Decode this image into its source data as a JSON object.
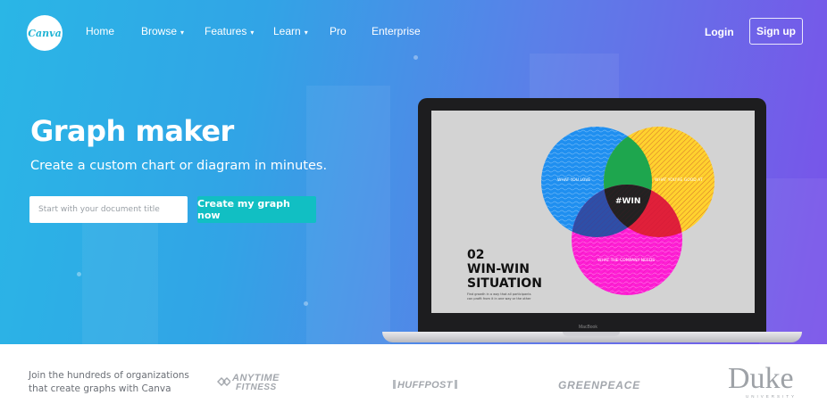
{
  "brand": {
    "logo_text": "Canva"
  },
  "nav": {
    "items": [
      {
        "label": "Home"
      },
      {
        "label": "Browse",
        "dropdown": true
      },
      {
        "label": "Features",
        "dropdown": true
      },
      {
        "label": "Learn",
        "dropdown": true
      },
      {
        "label": "Pro"
      },
      {
        "label": "Enterprise"
      }
    ],
    "login_label": "Login",
    "signup_label": "Sign up"
  },
  "hero": {
    "title": "Graph maker",
    "subtitle": "Create a custom chart or diagram in minutes.",
    "input_placeholder": "Start with your document title",
    "cta_label": "Create my graph now"
  },
  "device": {
    "base_label": "MacBook",
    "slide": {
      "number": "02",
      "heading_line1": "WIN-WIN",
      "heading_line2": "SITUATION",
      "caption_line1": "Find growth in a way that all participants",
      "caption_line2": "can profit from it in one way or the other",
      "circle_left_label": "WHAT YOU LOVE",
      "circle_right_label": "WHAT YOU'RE GOOD AT",
      "circle_bottom_label": "WHAT THE COMPANY NEEDS",
      "center_label": "#WIN"
    }
  },
  "footer": {
    "text_line1": "Join the hundreds of organizations",
    "text_line2": "that create graphs with Canva",
    "logos": {
      "anytime_line1": "ANYTIME",
      "anytime_line2": "FITNESS",
      "huffpost": "HUFFPOST",
      "greenpeace": "GREENPEACE",
      "duke": "Duke",
      "duke_sub": "UNIVERSITY"
    }
  },
  "colors": {
    "cta": "#11bfc3",
    "circle_blue": "#1f8ff0",
    "circle_yellow": "#ffd22e",
    "circle_magenta": "#ff1ed6",
    "overlap_green": "#1ea64e"
  }
}
